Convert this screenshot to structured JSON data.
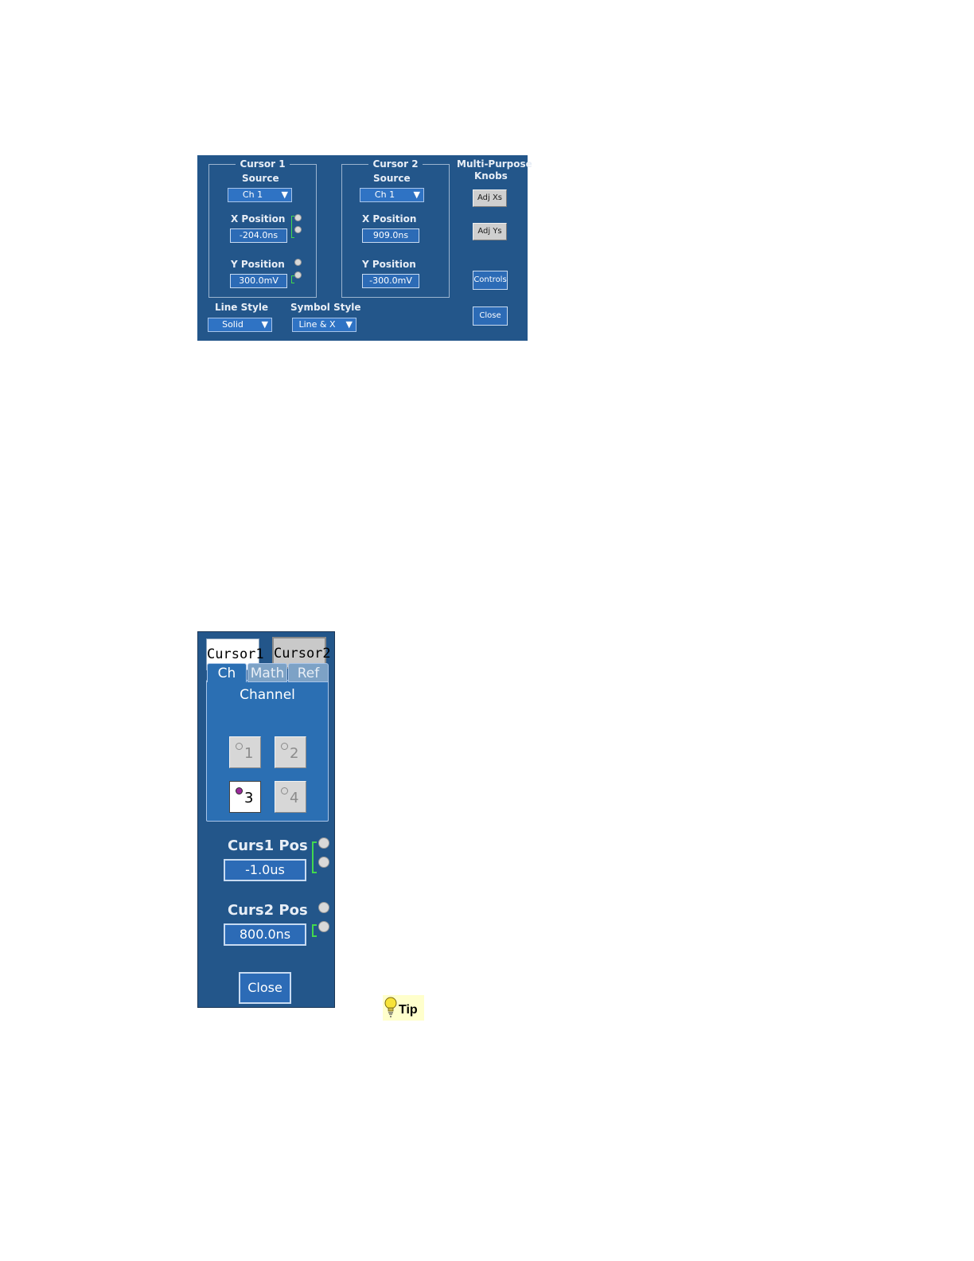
{
  "panel1": {
    "cursor1": {
      "title": "Cursor 1",
      "source_label": "Source",
      "source_value": "Ch 1",
      "x_label": "X Position",
      "x_value": "-204.0ns",
      "y_label": "Y Position",
      "y_value": "300.0mV"
    },
    "cursor2": {
      "title": "Cursor 2",
      "source_label": "Source",
      "source_value": "Ch 1",
      "x_label": "X Position",
      "x_value": "909.0ns",
      "y_label": "Y Position",
      "y_value": "-300.0mV"
    },
    "multipurpose": {
      "title_line1": "Multi-Purpose",
      "title_line2": "Knobs",
      "adj_xs": "Adj Xs",
      "adj_ys": "Adj Ys",
      "controls": "Controls",
      "close": "Close"
    },
    "line_style": {
      "label": "Line Style",
      "value": "Solid"
    },
    "symbol_style": {
      "label": "Symbol Style",
      "value": "Line & X"
    }
  },
  "panel2": {
    "cursor1_tab": "Cursor1",
    "cursor2_tab": "Cursor2",
    "tabs": [
      "Ch",
      "Math",
      "Ref"
    ],
    "channel_label": "Channel",
    "channels": [
      "1",
      "2",
      "3",
      "4"
    ],
    "selected_channel": "3",
    "curs1_label": "Curs1 Pos",
    "curs1_value": "-1.0us",
    "curs2_label": "Curs2 Pos",
    "curs2_value": "800.0ns",
    "close": "Close"
  },
  "tip": {
    "label": "Tip"
  },
  "colors": {
    "panel_bg": "#23568a",
    "field_bg": "#2c6bb6",
    "knob_indicator": "#43d94d",
    "selected_channel_dot": "#9b2a9b"
  }
}
